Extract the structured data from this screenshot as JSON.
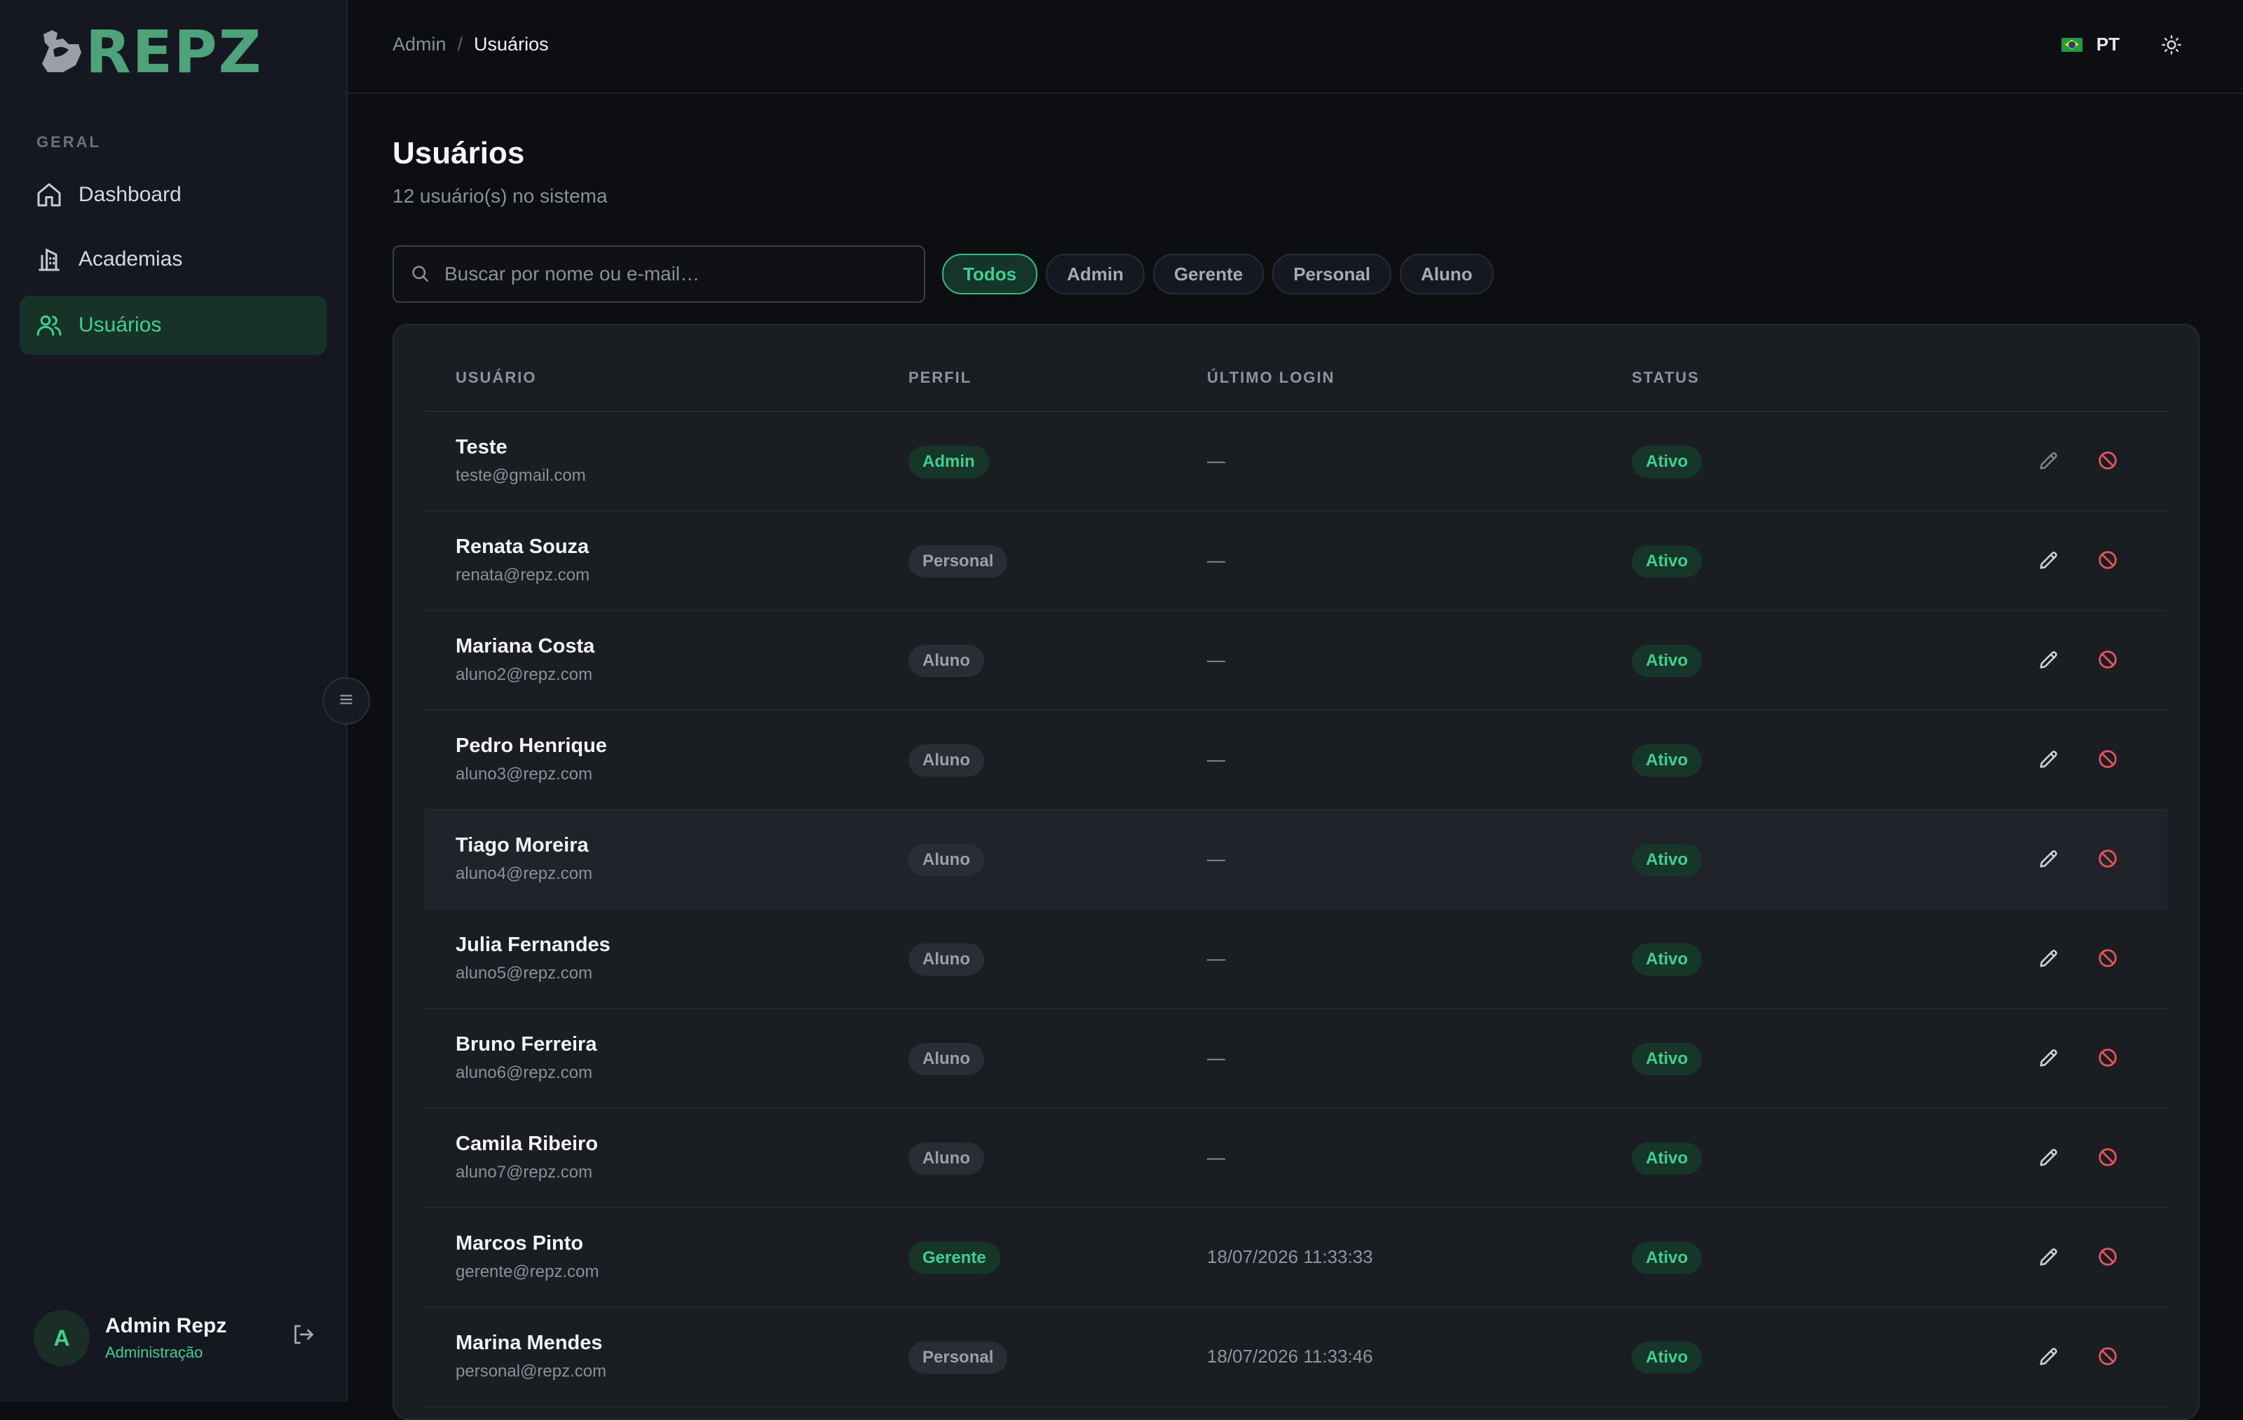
{
  "app": {
    "logo_text": "REPZ",
    "accent": "#3fd08f",
    "danger": "#e0555a"
  },
  "sidebar": {
    "section_label": "GERAL",
    "items": [
      {
        "label": "Dashboard",
        "icon": "home-icon",
        "active": false
      },
      {
        "label": "Academias",
        "icon": "building-icon",
        "active": false
      },
      {
        "label": "Usuários",
        "icon": "users-icon",
        "active": true
      }
    ],
    "user": {
      "initial": "A",
      "name": "Admin Repz",
      "role": "Administração"
    }
  },
  "topbar": {
    "breadcrumb": [
      "Admin",
      "Usuários"
    ],
    "language": "PT"
  },
  "main": {
    "title": "Usuários",
    "subtitle": "12 usuário(s) no sistema",
    "search_placeholder": "Buscar por nome ou e-mail…",
    "filters": [
      "Todos",
      "Admin",
      "Gerente",
      "Personal",
      "Aluno"
    ],
    "active_filter": "Todos"
  },
  "table": {
    "headers": {
      "user": "USUÁRIO",
      "profile": "PERFIL",
      "last_login": "ÚLTIMO LOGIN",
      "status": "STATUS"
    },
    "rows": [
      {
        "name": "Teste",
        "email": "teste@gmail.com",
        "profile": "Admin",
        "last_login": "—",
        "status": "Ativo"
      },
      {
        "name": "Renata Souza",
        "email": "renata@repz.com",
        "profile": "Personal",
        "last_login": "—",
        "status": "Ativo"
      },
      {
        "name": "Mariana Costa",
        "email": "aluno2@repz.com",
        "profile": "Aluno",
        "last_login": "—",
        "status": "Ativo"
      },
      {
        "name": "Pedro Henrique",
        "email": "aluno3@repz.com",
        "profile": "Aluno",
        "last_login": "—",
        "status": "Ativo"
      },
      {
        "name": "Tiago Moreira",
        "email": "aluno4@repz.com",
        "profile": "Aluno",
        "last_login": "—",
        "status": "Ativo"
      },
      {
        "name": "Julia Fernandes",
        "email": "aluno5@repz.com",
        "profile": "Aluno",
        "last_login": "—",
        "status": "Ativo"
      },
      {
        "name": "Bruno Ferreira",
        "email": "aluno6@repz.com",
        "profile": "Aluno",
        "last_login": "—",
        "status": "Ativo"
      },
      {
        "name": "Camila Ribeiro",
        "email": "aluno7@repz.com",
        "profile": "Aluno",
        "last_login": "—",
        "status": "Ativo"
      },
      {
        "name": "Marcos Pinto",
        "email": "gerente@repz.com",
        "profile": "Gerente",
        "last_login": "18/07/2026 11:33:33",
        "status": "Ativo"
      },
      {
        "name": "Marina Mendes",
        "email": "personal@repz.com",
        "profile": "Personal",
        "last_login": "18/07/2026 11:33:46",
        "status": "Ativo"
      }
    ]
  }
}
